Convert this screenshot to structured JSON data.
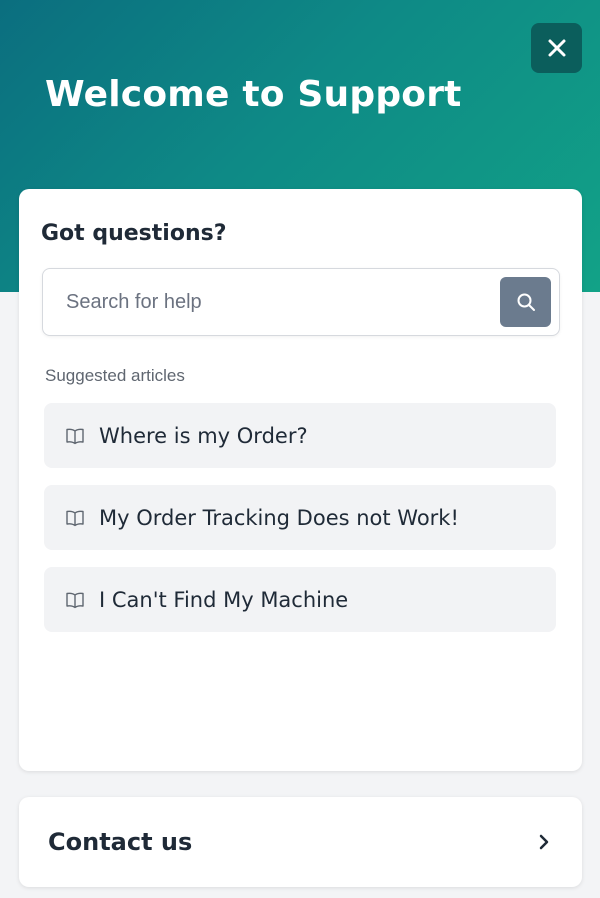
{
  "header": {
    "title": "Welcome to Support",
    "close_icon": "close-icon",
    "gradient": [
      "#0b6e7f",
      "#12a287"
    ]
  },
  "card": {
    "title": "Got questions?",
    "search": {
      "placeholder": "Search for help",
      "value": "",
      "button_icon": "search-icon"
    },
    "suggested_label": "Suggested articles",
    "articles": [
      {
        "label": "Where is my Order?",
        "icon": "book-icon"
      },
      {
        "label": "My Order Tracking Does not Work!",
        "icon": "book-icon"
      },
      {
        "label": "I Can't Find My Machine",
        "icon": "book-icon"
      }
    ]
  },
  "contact": {
    "label": "Contact us",
    "icon": "chevron-right-icon"
  },
  "colors": {
    "close_button": "#0b5e5c",
    "search_button": "#6b7b8e",
    "text_dark": "#1f2a37"
  }
}
